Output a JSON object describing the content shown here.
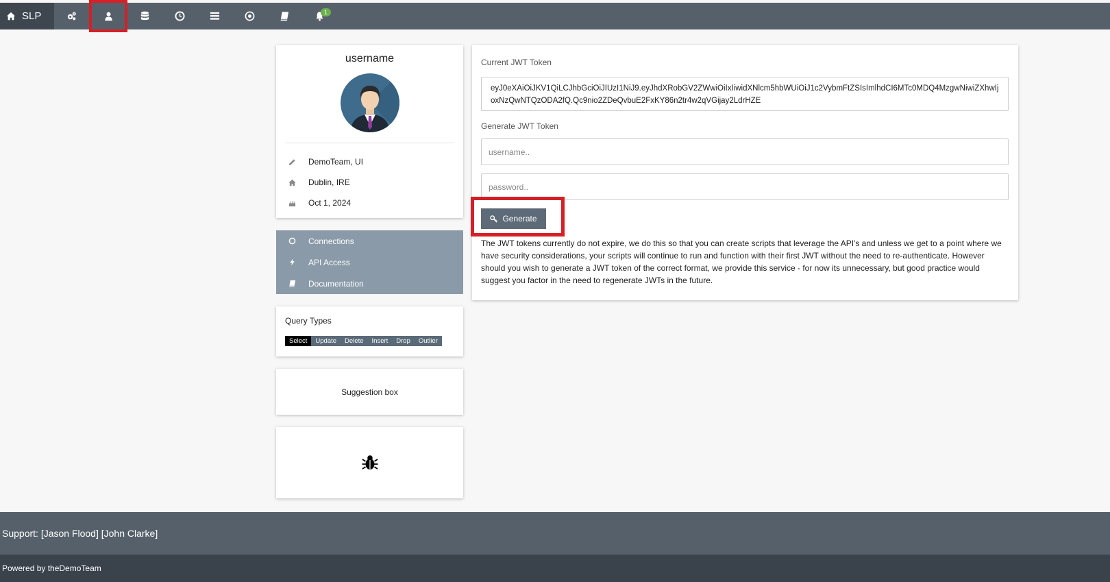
{
  "nav": {
    "brand": "SLP",
    "icons": [
      "home-icon",
      "cogs-icon",
      "user-icon",
      "database-icon",
      "clock-icon",
      "list-icon",
      "target-icon",
      "book-icon",
      "bell-icon"
    ],
    "notification_count": "1"
  },
  "profile": {
    "username": "username",
    "team": "DemoTeam, UI",
    "location": "Dublin, IRE",
    "date": "Oct 1, 2024"
  },
  "menu": {
    "items": [
      {
        "label": "Connections",
        "icon": "circle-notch-icon"
      },
      {
        "label": "API Access",
        "icon": "bolt-icon"
      },
      {
        "label": "Documentation",
        "icon": "book-icon"
      }
    ]
  },
  "query_types": {
    "title": "Query Types",
    "types": [
      "Select",
      "Update",
      "Delete",
      "Insert",
      "Drop",
      "Outlier"
    ],
    "selected": "Select"
  },
  "suggestion": {
    "label": "Suggestion box"
  },
  "jwt": {
    "current_label": "Current JWT Token",
    "token": "eyJ0eXAiOiJKV1QiLCJhbGciOiJIUzI1NiJ9.eyJhdXRobGV2ZWwiOiIxIiwidXNlcm5hbWUiOiJ1c2VybmFtZSIsImlhdCI6MTc0MDQ4MzgwNiwiZXhwIjoxNzQwNTQzODA2fQ.Qc9nio2ZDeQvbuE2FxKY86n2tr4w2qVGijay2LdrHZE",
    "generate_label": "Generate JWT Token",
    "username_placeholder": "username..",
    "password_placeholder": "password..",
    "button_label": "Generate",
    "description": "The JWT tokens currently do not expire, we do this so that you can create scripts that leverage the API's and unless we get to a point where we have security considerations, your scripts will continue to run and function with their first JWT without the need to re-authenticate. However should you wish to generate a JWT token of the correct format, we provide this service - for now its unnecessary, but good practice would suggest you factor in the need to regenerate JWTs in the future."
  },
  "footer": {
    "support": "Support: [Jason Flood] [John Clarke]",
    "powered": "Powered by theDemoTeam"
  },
  "colors": {
    "nav_bg": "#56606a",
    "brand_bg": "#3e4650",
    "highlight": "#d61f26",
    "menu_bg": "#8a9aa8",
    "badge": "#6ab04c"
  }
}
